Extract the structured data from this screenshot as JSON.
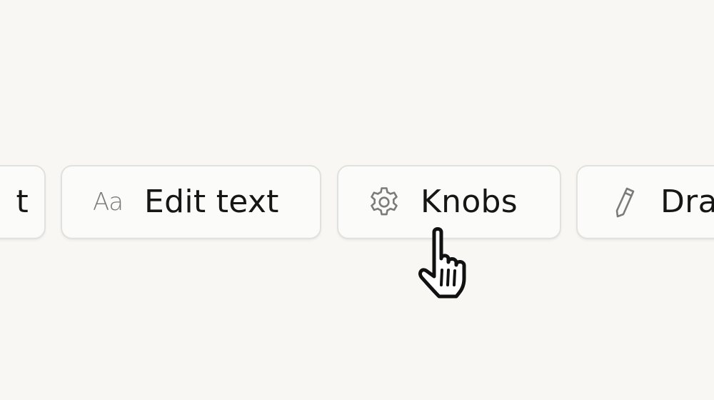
{
  "toolbar": {
    "items": [
      {
        "label": "t",
        "icon": "none"
      },
      {
        "label": "Edit text",
        "icon": "Aa",
        "icon_name": "text-format-icon"
      },
      {
        "label": "Knobs",
        "icon": "gear-icon",
        "state": "hover"
      },
      {
        "label": "Dra",
        "icon": "pencil-icon"
      }
    ]
  },
  "cursor": {
    "type": "pointer-hand"
  },
  "colors": {
    "background": "#f8f7f4",
    "chip_background": "#fbfbf9",
    "chip_border": "#e1e1de",
    "label": "#161616",
    "icon": "#7b7b7b"
  }
}
